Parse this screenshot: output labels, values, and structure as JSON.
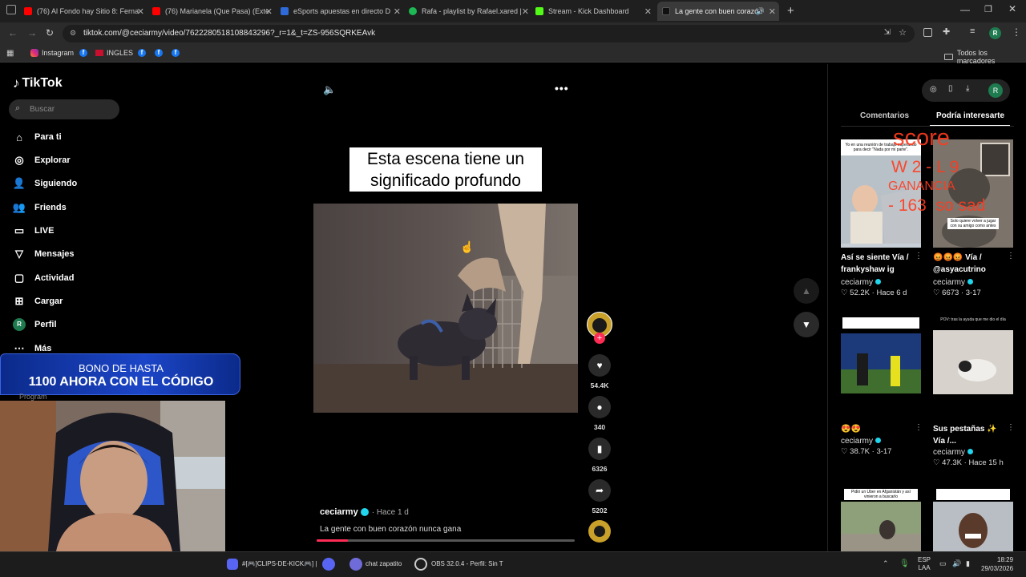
{
  "browser": {
    "tabs": [
      {
        "title": "(76) Al Fondo hay Sitio 8: Ferna",
        "color": "#ff0000"
      },
      {
        "title": "(76) Marianela (Que Pasa) (Exte",
        "color": "#ff0000"
      },
      {
        "title": "eSports apuestas en directo D",
        "color": "#2e6bd8"
      },
      {
        "title": "Rafa - playlist by Rafael.xared |",
        "color": "#1db954"
      },
      {
        "title": "Stream - Kick Dashboard",
        "color": "#53fc18"
      },
      {
        "title": "La gente con buen corazón",
        "color": "#111111"
      }
    ],
    "url": "tiktok.com/@ceciarmy/video/7622280518108843296?_r=1&_t=ZS-956SQRKEAvk",
    "bookmarks": [
      "Instagram",
      "INGLES"
    ],
    "all_bookmarks": "Todos los marcadores"
  },
  "tiktok": {
    "logo": "TikTok",
    "search_placeholder": "Buscar",
    "nav": [
      {
        "label": "Para ti",
        "icon": "home-icon"
      },
      {
        "label": "Explorar",
        "icon": "compass-icon"
      },
      {
        "label": "Siguiendo",
        "icon": "following-icon"
      },
      {
        "label": "Friends",
        "icon": "friends-icon"
      },
      {
        "label": "LIVE",
        "icon": "live-icon"
      },
      {
        "label": "Mensajes",
        "icon": "messages-icon"
      },
      {
        "label": "Actividad",
        "icon": "activity-icon"
      },
      {
        "label": "Cargar",
        "icon": "upload-icon"
      },
      {
        "label": "Perfil",
        "icon": "profile-avatar"
      },
      {
        "label": "Más",
        "icon": "more-icon"
      }
    ],
    "avatar_letter": "R",
    "video": {
      "caption": "Esta escena tiene un\nsignificado profundo",
      "author": "ceciarmy",
      "time": "· Hace 1 d",
      "description": "La gente con buen corazón nunca gana",
      "progress_fraction": 0.12
    },
    "actions": {
      "likes": "54.4K",
      "comments": "340",
      "saves": "6326",
      "shares": "5202"
    },
    "panel_tabs": {
      "comments": "Comentarios",
      "suggested": "Podría interesarte"
    },
    "cards": [
      {
        "title": "Así se siente Vía /\nfrankyshaw ig",
        "user": "ceciarmy",
        "likes": "52.2K",
        "time": "Hace 6 d",
        "thumb_text": "Yo en una reunión de trabajo esperando para decir \"Nada por mi parte\"."
      },
      {
        "title": "😡😡😡 Vía /\n@asyacutrino",
        "user": "ceciarmy",
        "likes": "6673",
        "time": "3-17",
        "thumb_text": "Solo quiere volver a jugar con su amigo como antes"
      },
      {
        "title": "😍😍",
        "user": "ceciarmy",
        "likes": "38.7K",
        "time": "3-17",
        "thumb_text": ""
      },
      {
        "title": "Sus pestañas ✨\nVía /...",
        "user": "ceciarmy",
        "likes": "47.3K",
        "time": "Hace 15 h",
        "thumb_text": "POV: tras la ayuda que me dio el día"
      },
      {
        "title": "",
        "user": "",
        "likes": "",
        "time": "",
        "thumb_text": "Pidió un Uber en Afganistán y así vinieron a buscarlo"
      },
      {
        "title": "",
        "user": "",
        "likes": "",
        "time": "",
        "thumb_text": ""
      }
    ]
  },
  "overlay": {
    "score_title": "score",
    "score_line1": "W 2 - L 9",
    "score_line2": "GANANCIA",
    "score_line3": "- 163  so sad",
    "promo_line1": "BONO DE HASTA",
    "promo_line2": "1100 AHORA CON EL CÓDIGO",
    "program_label": "Program"
  },
  "taskbar": {
    "items": [
      "#[🎮]CLIPS-DE-KICK🎮] |",
      "chat zapatito",
      "OBS 32.0.4 - Perfil: Sin T"
    ],
    "lang": "ESP",
    "lang2": "LAA",
    "time": "18:29",
    "date": "29/03/2026"
  }
}
